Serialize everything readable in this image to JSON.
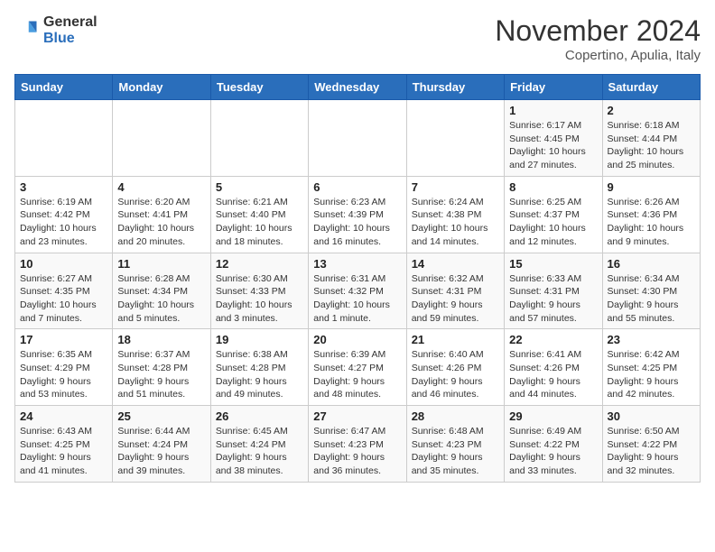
{
  "header": {
    "logo_general": "General",
    "logo_blue": "Blue",
    "month_title": "November 2024",
    "location": "Copertino, Apulia, Italy"
  },
  "days_of_week": [
    "Sunday",
    "Monday",
    "Tuesday",
    "Wednesday",
    "Thursday",
    "Friday",
    "Saturday"
  ],
  "weeks": [
    {
      "days": [
        {
          "number": "",
          "info": ""
        },
        {
          "number": "",
          "info": ""
        },
        {
          "number": "",
          "info": ""
        },
        {
          "number": "",
          "info": ""
        },
        {
          "number": "",
          "info": ""
        },
        {
          "number": "1",
          "info": "Sunrise: 6:17 AM\nSunset: 4:45 PM\nDaylight: 10 hours and 27 minutes."
        },
        {
          "number": "2",
          "info": "Sunrise: 6:18 AM\nSunset: 4:44 PM\nDaylight: 10 hours and 25 minutes."
        }
      ]
    },
    {
      "days": [
        {
          "number": "3",
          "info": "Sunrise: 6:19 AM\nSunset: 4:42 PM\nDaylight: 10 hours and 23 minutes."
        },
        {
          "number": "4",
          "info": "Sunrise: 6:20 AM\nSunset: 4:41 PM\nDaylight: 10 hours and 20 minutes."
        },
        {
          "number": "5",
          "info": "Sunrise: 6:21 AM\nSunset: 4:40 PM\nDaylight: 10 hours and 18 minutes."
        },
        {
          "number": "6",
          "info": "Sunrise: 6:23 AM\nSunset: 4:39 PM\nDaylight: 10 hours and 16 minutes."
        },
        {
          "number": "7",
          "info": "Sunrise: 6:24 AM\nSunset: 4:38 PM\nDaylight: 10 hours and 14 minutes."
        },
        {
          "number": "8",
          "info": "Sunrise: 6:25 AM\nSunset: 4:37 PM\nDaylight: 10 hours and 12 minutes."
        },
        {
          "number": "9",
          "info": "Sunrise: 6:26 AM\nSunset: 4:36 PM\nDaylight: 10 hours and 9 minutes."
        }
      ]
    },
    {
      "days": [
        {
          "number": "10",
          "info": "Sunrise: 6:27 AM\nSunset: 4:35 PM\nDaylight: 10 hours and 7 minutes."
        },
        {
          "number": "11",
          "info": "Sunrise: 6:28 AM\nSunset: 4:34 PM\nDaylight: 10 hours and 5 minutes."
        },
        {
          "number": "12",
          "info": "Sunrise: 6:30 AM\nSunset: 4:33 PM\nDaylight: 10 hours and 3 minutes."
        },
        {
          "number": "13",
          "info": "Sunrise: 6:31 AM\nSunset: 4:32 PM\nDaylight: 10 hours and 1 minute."
        },
        {
          "number": "14",
          "info": "Sunrise: 6:32 AM\nSunset: 4:31 PM\nDaylight: 9 hours and 59 minutes."
        },
        {
          "number": "15",
          "info": "Sunrise: 6:33 AM\nSunset: 4:31 PM\nDaylight: 9 hours and 57 minutes."
        },
        {
          "number": "16",
          "info": "Sunrise: 6:34 AM\nSunset: 4:30 PM\nDaylight: 9 hours and 55 minutes."
        }
      ]
    },
    {
      "days": [
        {
          "number": "17",
          "info": "Sunrise: 6:35 AM\nSunset: 4:29 PM\nDaylight: 9 hours and 53 minutes."
        },
        {
          "number": "18",
          "info": "Sunrise: 6:37 AM\nSunset: 4:28 PM\nDaylight: 9 hours and 51 minutes."
        },
        {
          "number": "19",
          "info": "Sunrise: 6:38 AM\nSunset: 4:28 PM\nDaylight: 9 hours and 49 minutes."
        },
        {
          "number": "20",
          "info": "Sunrise: 6:39 AM\nSunset: 4:27 PM\nDaylight: 9 hours and 48 minutes."
        },
        {
          "number": "21",
          "info": "Sunrise: 6:40 AM\nSunset: 4:26 PM\nDaylight: 9 hours and 46 minutes."
        },
        {
          "number": "22",
          "info": "Sunrise: 6:41 AM\nSunset: 4:26 PM\nDaylight: 9 hours and 44 minutes."
        },
        {
          "number": "23",
          "info": "Sunrise: 6:42 AM\nSunset: 4:25 PM\nDaylight: 9 hours and 42 minutes."
        }
      ]
    },
    {
      "days": [
        {
          "number": "24",
          "info": "Sunrise: 6:43 AM\nSunset: 4:25 PM\nDaylight: 9 hours and 41 minutes."
        },
        {
          "number": "25",
          "info": "Sunrise: 6:44 AM\nSunset: 4:24 PM\nDaylight: 9 hours and 39 minutes."
        },
        {
          "number": "26",
          "info": "Sunrise: 6:45 AM\nSunset: 4:24 PM\nDaylight: 9 hours and 38 minutes."
        },
        {
          "number": "27",
          "info": "Sunrise: 6:47 AM\nSunset: 4:23 PM\nDaylight: 9 hours and 36 minutes."
        },
        {
          "number": "28",
          "info": "Sunrise: 6:48 AM\nSunset: 4:23 PM\nDaylight: 9 hours and 35 minutes."
        },
        {
          "number": "29",
          "info": "Sunrise: 6:49 AM\nSunset: 4:22 PM\nDaylight: 9 hours and 33 minutes."
        },
        {
          "number": "30",
          "info": "Sunrise: 6:50 AM\nSunset: 4:22 PM\nDaylight: 9 hours and 32 minutes."
        }
      ]
    }
  ]
}
